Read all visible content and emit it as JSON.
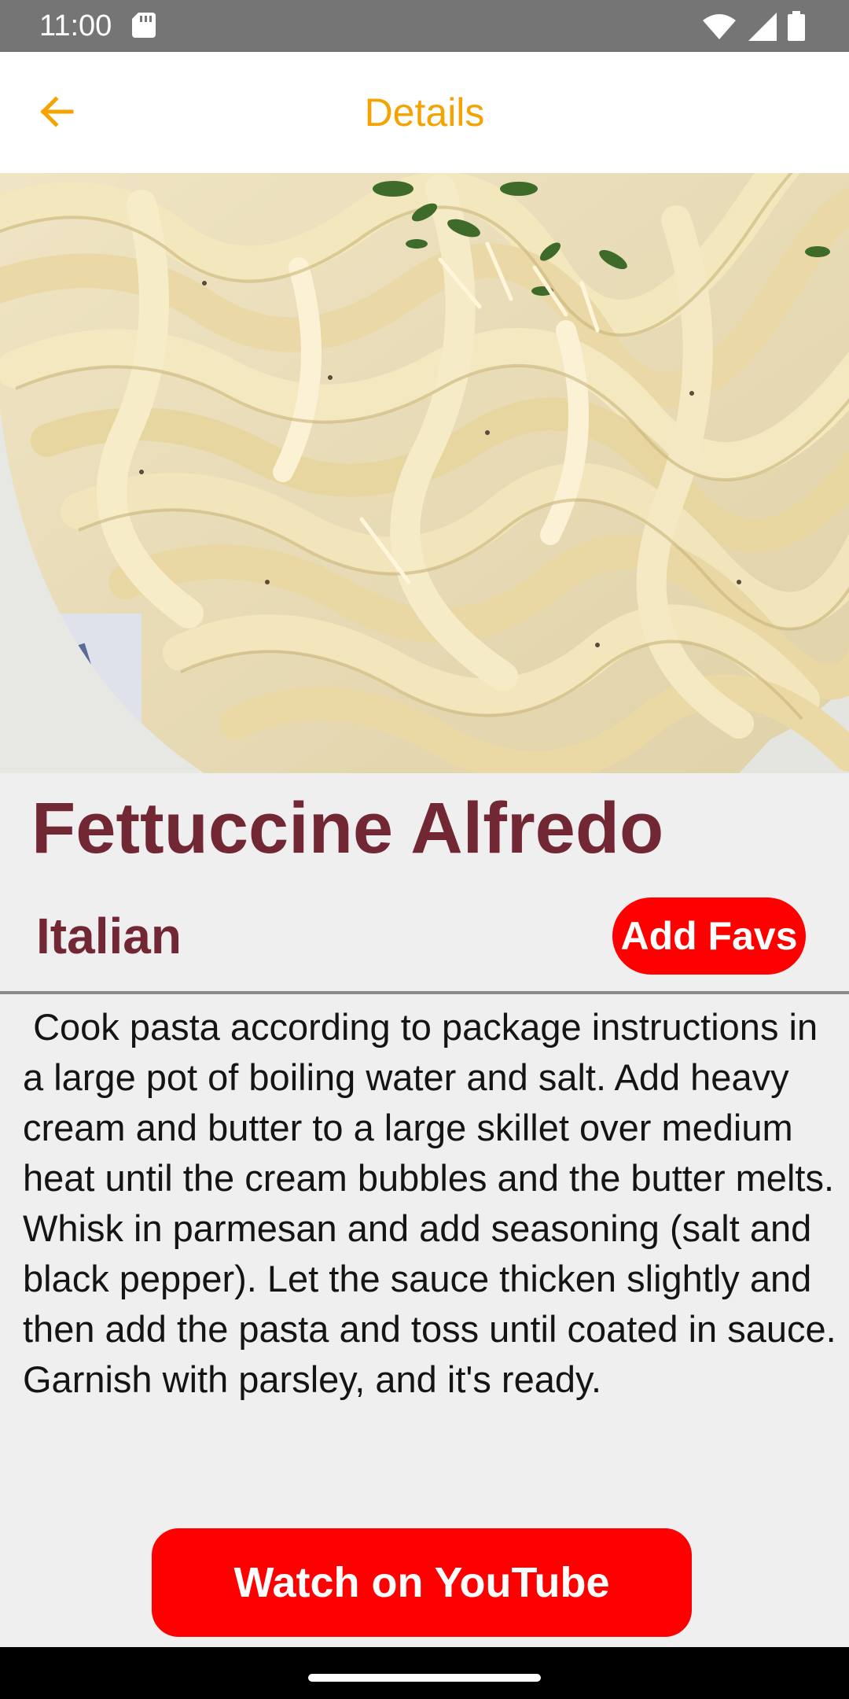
{
  "status_bar": {
    "time": "11:00",
    "icons": [
      "sd-card-icon",
      "wifi-icon",
      "signal-icon",
      "battery-icon"
    ]
  },
  "app_bar": {
    "title": "Details",
    "back_icon": "arrow-back-icon",
    "accent_color": "#f5a300"
  },
  "hero_image": {
    "description_icon": "pasta-photo"
  },
  "recipe": {
    "name": "Fettuccine Alfredo",
    "area": "Italian",
    "instructions": " Cook pasta according to package instructions in a large pot of boiling water and salt. Add heavy cream and butter to a large skillet over medium heat until the cream bubbles and the butter melts. Whisk in parmesan and add seasoning (salt and black pepper). Let the sauce thicken slightly and then add the pasta and toss until coated in sauce. Garnish with parsley, and it's ready."
  },
  "buttons": {
    "add_favs": "Add Favs",
    "youtube": "Watch on YouTube"
  },
  "colors": {
    "title": "#722834",
    "button": "#ff0000",
    "background": "#f0efef"
  }
}
